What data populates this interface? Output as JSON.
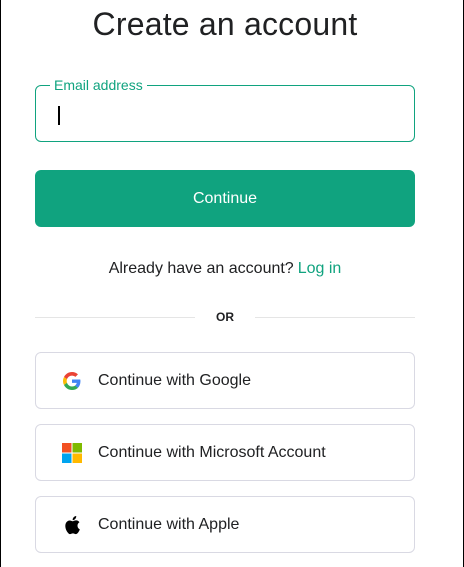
{
  "page": {
    "title": "Create an account"
  },
  "email": {
    "legend": "Email address",
    "value": "",
    "placeholder": ""
  },
  "continue_button": {
    "label": "Continue"
  },
  "login_prompt": {
    "text": "Already have an account?",
    "link": "Log in"
  },
  "divider": {
    "text": "OR"
  },
  "social": [
    {
      "label": "Continue with Google",
      "icon": "google-icon"
    },
    {
      "label": "Continue with Microsoft Account",
      "icon": "microsoft-icon"
    },
    {
      "label": "Continue with Apple",
      "icon": "apple-icon"
    }
  ],
  "colors": {
    "accent": "#10a37f",
    "text": "#202123",
    "border": "#d9d9e3"
  }
}
